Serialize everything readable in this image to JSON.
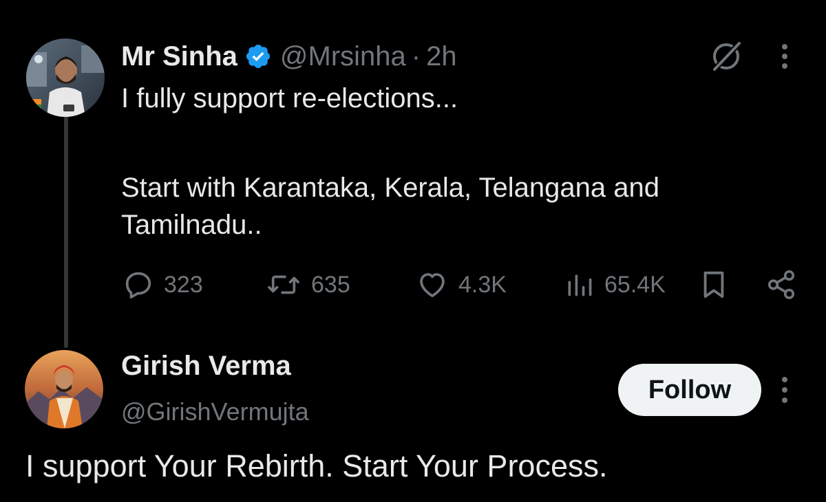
{
  "tweet": {
    "author_name": "Mr Sinha",
    "handle": "@Mrsinha",
    "separator": "·",
    "time": "2h",
    "verified_icon": "verified-badge-icon",
    "text_line_1": "I fully support re-elections...",
    "text_line_2": "Start with Karantaka, Kerala, Telangana and",
    "text_line_3": "Tamilnadu..",
    "stats": {
      "replies": "323",
      "retweets": "635",
      "likes": "4.3K",
      "views": "65.4K"
    }
  },
  "reply": {
    "author_name": "Girish Verma",
    "handle": "@GirishVermujta",
    "follow_label": "Follow",
    "text": "I support Your Rebirth. Start Your Process."
  },
  "colors": {
    "background": "#000000",
    "text_primary": "#e7e9ea",
    "text_secondary": "#71767b",
    "verified_blue": "#1d9bf0",
    "follow_bg": "#eff3f4",
    "thread_line": "#333639"
  },
  "icons": [
    "grok-icon",
    "more-icon",
    "reply-icon",
    "retweet-icon",
    "like-icon",
    "views-icon",
    "bookmark-icon",
    "share-icon"
  ]
}
